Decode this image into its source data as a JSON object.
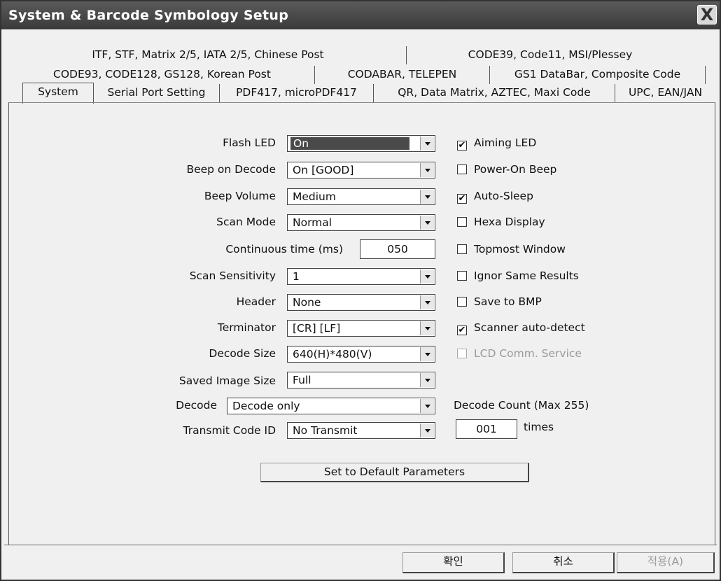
{
  "window": {
    "title": "System & Barcode Symbology Setup",
    "close_label": "X"
  },
  "tabs": {
    "row1": [
      "ITF, STF, Matrix 2/5, IATA 2/5, Chinese Post",
      "CODE39, Code11, MSI/Plessey"
    ],
    "row2": [
      "CODE93, CODE128, GS128, Korean Post",
      "CODABAR, TELEPEN",
      "GS1 DataBar, Composite Code"
    ],
    "row3": [
      "System",
      "Serial Port Setting",
      "PDF417, microPDF417",
      "QR, Data Matrix, AZTEC, Maxi Code",
      "UPC, EAN/JAN"
    ],
    "active": "System"
  },
  "settings": {
    "flash_led": {
      "label": "Flash LED",
      "value": "On"
    },
    "beep_on_decode": {
      "label": "Beep on Decode",
      "value": "On [GOOD]"
    },
    "beep_volume": {
      "label": "Beep Volume",
      "value": "Medium"
    },
    "scan_mode": {
      "label": "Scan Mode",
      "value": "Normal"
    },
    "continuous_time": {
      "label": "Continuous time (ms)",
      "value": "050"
    },
    "scan_sensitivity": {
      "label": "Scan Sensitivity",
      "value": "1"
    },
    "header": {
      "label": "Header",
      "value": "None"
    },
    "terminator": {
      "label": "Terminator",
      "value": "[CR] [LF]"
    },
    "decode_size": {
      "label": "Decode Size",
      "value": "640(H)*480(V)"
    },
    "saved_image_size": {
      "label": "Saved Image Size",
      "value": "Full"
    },
    "decode": {
      "label": "Decode",
      "value": "Decode only"
    },
    "transmit_code_id": {
      "label": "Transmit Code ID",
      "value": "No Transmit"
    }
  },
  "checkboxes": {
    "aiming_led": {
      "label": "Aiming LED",
      "checked": true
    },
    "power_on_beep": {
      "label": "Power-On Beep",
      "checked": false
    },
    "auto_sleep": {
      "label": "Auto-Sleep",
      "checked": true
    },
    "hexa_display": {
      "label": "Hexa Display",
      "checked": false
    },
    "topmost_window": {
      "label": "Topmost Window",
      "checked": false
    },
    "ignor_same_results": {
      "label": "Ignor Same Results",
      "checked": false
    },
    "save_to_bmp": {
      "label": "Save to BMP",
      "checked": false
    },
    "scanner_auto_detect": {
      "label": "Scanner auto-detect",
      "checked": true
    },
    "lcd_comm_service": {
      "label": "LCD Comm. Service",
      "checked": false,
      "disabled": true
    }
  },
  "decode_count": {
    "label": "Decode Count (Max 255)",
    "value": "001",
    "unit": "times"
  },
  "buttons": {
    "default_params": "Set to Default Parameters",
    "ok": "확인",
    "cancel": "취소",
    "apply": "적용(A)"
  },
  "check_mark": "✔"
}
